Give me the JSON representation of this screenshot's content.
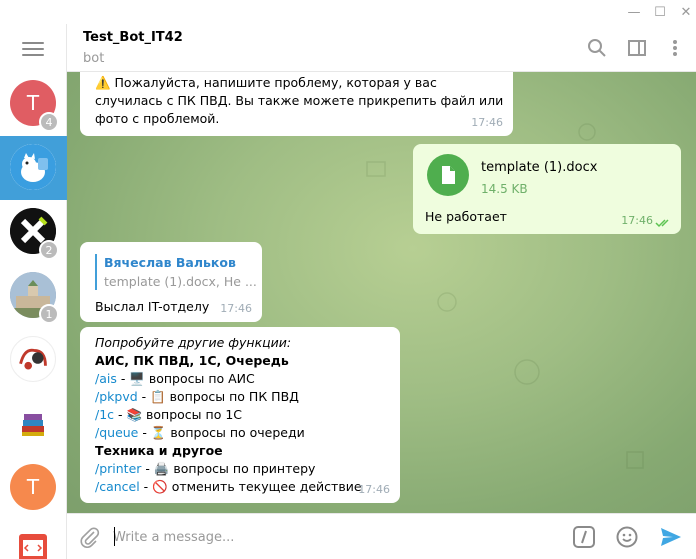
{
  "window": {
    "minimize": "—",
    "maximize": "☐",
    "close": "✕"
  },
  "sidebar": {
    "chats": [
      {
        "avatar_letter": "T",
        "color": "#e05d63",
        "unread": "4"
      },
      {
        "avatar_letter": "",
        "color": "#419fd9",
        "unread": "",
        "active": true
      },
      {
        "avatar_letter": "",
        "color": "#111111",
        "unread": "2"
      },
      {
        "avatar_letter": "",
        "color": "#8fa6bd",
        "unread": "1"
      },
      {
        "avatar_letter": "",
        "color": "#ffffff",
        "unread": ""
      },
      {
        "avatar_letter": "",
        "color": "#ffffff",
        "unread": ""
      },
      {
        "avatar_letter": "T",
        "color": "#f6894d",
        "unread": ""
      },
      {
        "avatar_letter": "",
        "color": "#ffffff",
        "unread": ""
      }
    ]
  },
  "header": {
    "title": "Test_Bot_IT42",
    "status": "bot"
  },
  "messages": {
    "m1": {
      "text": "⚠️ Пожалуйста, напишите проблему, которая у вас случилась с ПК ПВД. Вы также можете прикрепить файл или фото с проблемой.",
      "time": "17:46"
    },
    "m2": {
      "file_name": "template (1).docx",
      "file_size": "14.5 KB",
      "text": "Не работает",
      "time": "17:46"
    },
    "m3": {
      "reply_author": "Вячеслав Вальков",
      "reply_text": "template (1).docx, Не ...",
      "text": "Выслал IT-отделу",
      "time": "17:46"
    },
    "m4": {
      "intro": "Попробуйте другие функции:",
      "section1": "АИС, ПК ПВД, 1С, Очередь",
      "cmd_ais": "/ais",
      "ais_text": " - 🖥️ вопросы по АИС",
      "cmd_pkpvd": "/pkpvd",
      "pkpvd_text": " - 📋 вопросы по ПК ПВД",
      "cmd_1c": "/1c",
      "c1_text": " - 📚 вопросы по 1С",
      "cmd_queue": "/queue",
      "queue_text": " - ⏳ вопросы по очереди",
      "section2": "Техника и другое",
      "cmd_printer": "/printer",
      "printer_text": " - 🖨️ вопросы по принтеру",
      "cmd_cancel": "/cancel",
      "cancel_text": " - 🚫 отменить текущее действие",
      "time": "17:46"
    }
  },
  "composer": {
    "placeholder": "Write a message...",
    "value": ""
  },
  "colors": {
    "accent": "#419fd9",
    "link": "#168acd",
    "outgoing": "#effdde",
    "send": "#40a7e3"
  }
}
